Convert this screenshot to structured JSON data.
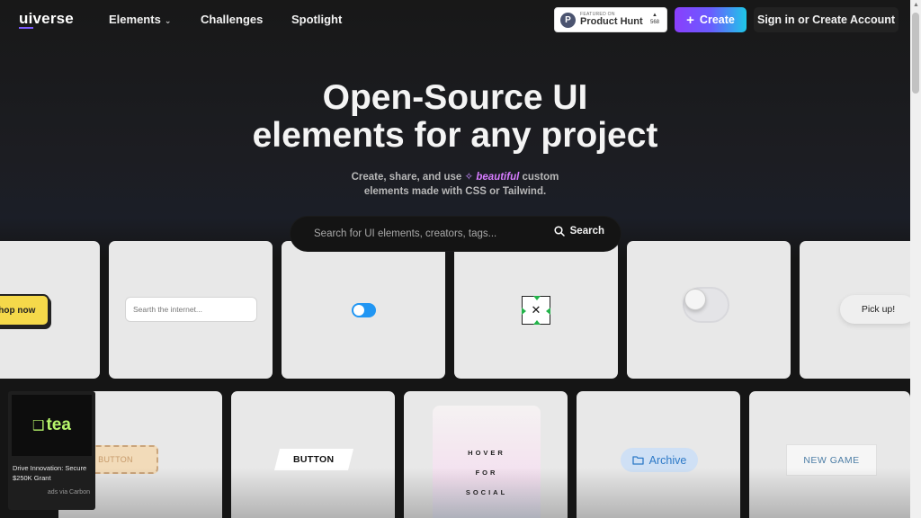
{
  "nav": {
    "logo_ui": "ui",
    "logo_rest": "verse",
    "links": [
      {
        "label": "Elements",
        "has_dropdown": true
      },
      {
        "label": "Challenges"
      },
      {
        "label": "Spotlight"
      }
    ],
    "product_hunt": {
      "small": "FEATURED ON",
      "big": "Product Hunt",
      "votes": "568",
      "letter": "P"
    },
    "create_label": "Create",
    "signin_label": "Sign in or Create Account"
  },
  "hero": {
    "title_line1": "Open-Source UI",
    "title_line2": "elements for any project",
    "sub_part1": "Create, share, and use",
    "sub_highlight": "beautiful",
    "sub_part2": "custom",
    "sub_line2": "elements made with CSS or Tailwind."
  },
  "search": {
    "placeholder": "Search for UI elements, creators, tags...",
    "button_label": "Search"
  },
  "cards_row1": {
    "shop_now": "Shop now",
    "search_internet_placeholder": "Searth the internet...",
    "x_symbol": "✕",
    "pick_up": "Pick up!"
  },
  "cards_row2": {
    "button_dashed": "BUTTON",
    "button_skew": "BUTTON",
    "hover_words": [
      "HOVER",
      "FOR",
      "SOCIAL"
    ],
    "archive": "Archive",
    "new_game": "NEW GAME"
  },
  "ad": {
    "brand": "tea",
    "text": "Drive Innovation: Secure $250K Grant",
    "via": "ads via Carbon"
  },
  "colors": {
    "accent_purple": "#8a3ffc",
    "accent_cyan": "#1ec8e8",
    "toggle_blue": "#2196f3",
    "shop_yellow": "#f5d94a"
  }
}
